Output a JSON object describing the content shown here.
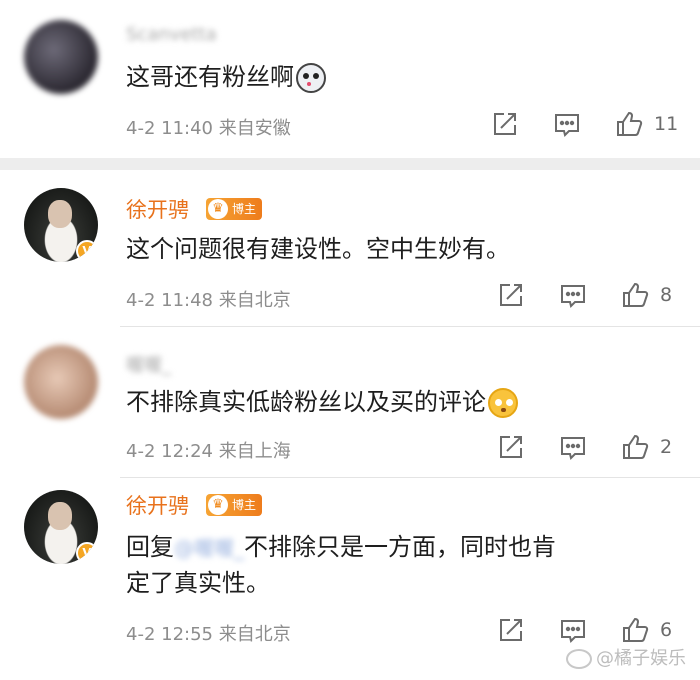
{
  "comments": [
    {
      "username": "Scanvetta",
      "text": "这哥还有粉丝啊",
      "emoji": "doge-emoji",
      "time": "4-2 11:40",
      "location": "来自安徽",
      "likes": "11"
    },
    {
      "username": "徐开骋",
      "badge": "博主",
      "text": "这个问题很有建设性。空中生妙有。",
      "time": "4-2 11:48",
      "location": "来自北京",
      "likes": "8"
    },
    {
      "username": "喔喔_",
      "text": "不排除真实低龄粉丝以及买的评论",
      "emoji": "eye-roll-emoji",
      "time": "4-2 12:24",
      "location": "来自上海",
      "likes": "2"
    },
    {
      "username": "徐开骋",
      "badge": "博主",
      "reply_prefix": "回复",
      "reply_target": "@喔喔_",
      "text_line1": "不排除只是一方面，同时也肯",
      "text_line2": "定了真实性。",
      "time": "4-2 12:55",
      "location": "来自北京",
      "likes": "6"
    }
  ],
  "watermark": "@橘子娱乐",
  "icons": {
    "share": "share-icon",
    "comment": "comment-icon",
    "like": "thumbs-up-icon",
    "crown": "crown-icon",
    "verified": "verified-v-icon"
  },
  "colors": {
    "username": "#e8721c",
    "meta": "#8d8d8d",
    "badge": "#f08a1c",
    "separator": "#ededed"
  }
}
